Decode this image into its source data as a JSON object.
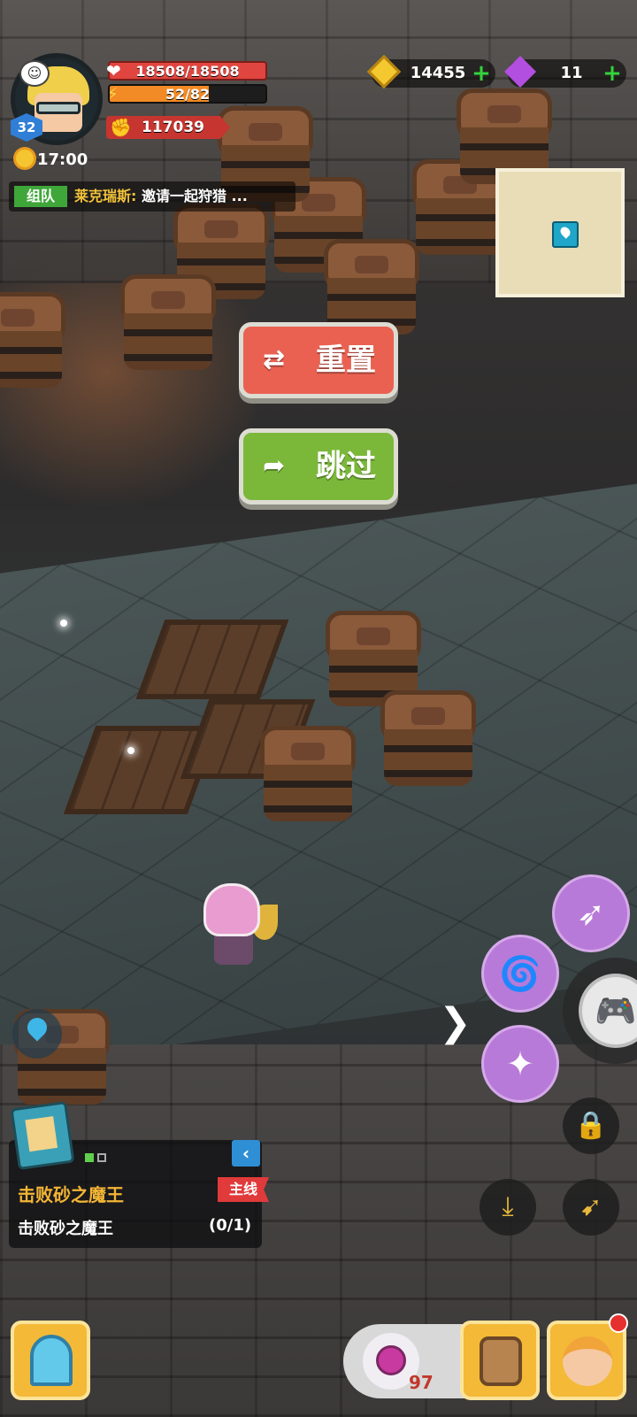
{
  "player": {
    "level": "32",
    "hp": "18508/18508",
    "stamina": "52/82",
    "stamina_fraction": 0.634,
    "power": "117039",
    "time": "17:00"
  },
  "chat": {
    "tag": "组队",
    "sender": "莱克瑞斯:",
    "message": "邀请一起狩猎 ..."
  },
  "currency": {
    "gold": "14455",
    "gems": "11"
  },
  "buttons": {
    "reset": "重置",
    "skip": "跳过"
  },
  "quest": {
    "title": "击败砂之魔王",
    "tag": "主线",
    "description": "击败砂之魔王",
    "progress": "(0/1)"
  },
  "inventory": {
    "potion_count": "97"
  },
  "icons": {
    "reset": "swap-arrows-icon",
    "skip": "forward-arrow-icon",
    "skill_1": "triple-arrow-icon",
    "skill_2": "tornado-icon",
    "skill_3": "crystal-shatter-icon",
    "gamepad": "gamepad-icon",
    "lock": "lock-icon",
    "dodge": "roll-icon",
    "weapon": "crossbow-icon"
  },
  "colors": {
    "hp": "#e0453f",
    "stamina": "#f28a25",
    "reset_button": "#ea6152",
    "skip_button": "#7bb83a",
    "skill": "#b87ad8",
    "quest_title": "#f3b535"
  }
}
